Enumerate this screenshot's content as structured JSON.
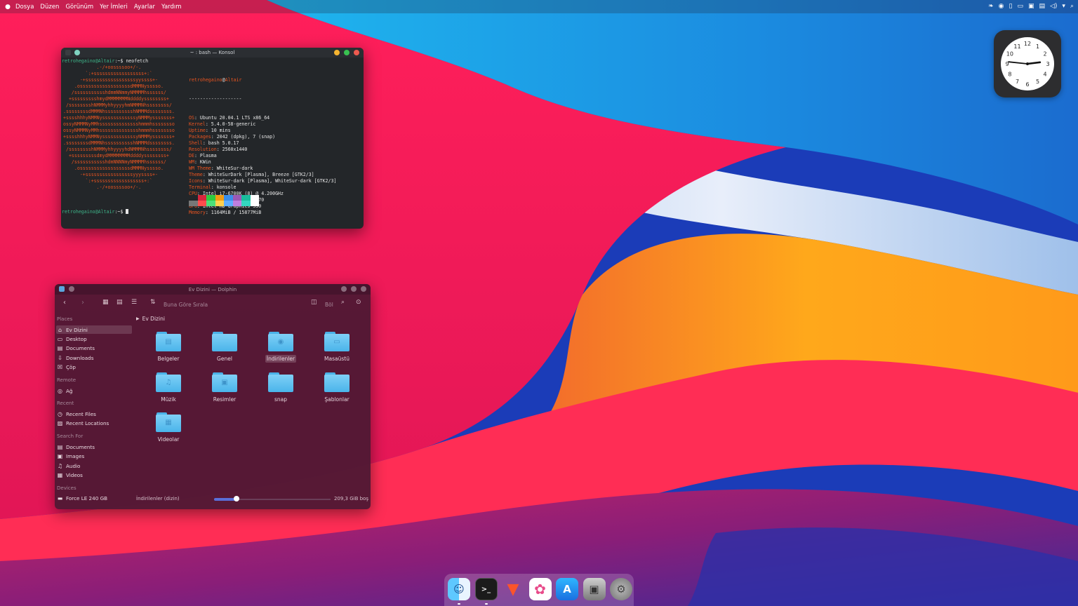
{
  "menubar": {
    "apple_icon": "apple-icon",
    "items": [
      "Dosya",
      "Düzen",
      "Görünüm",
      "Yer İmleri",
      "Ayarlar",
      "Yardım"
    ],
    "tray_icons": [
      "kde-connect-icon",
      "location-icon",
      "clipboard-icon",
      "display-icon",
      "battery-icon",
      "network-icon",
      "volume-icon",
      "chevron-down-icon",
      "search-icon"
    ]
  },
  "clock": {
    "numbers": [
      "12",
      "1",
      "2",
      "3",
      "4",
      "5",
      "6",
      "7",
      "8",
      "9",
      "10",
      "11"
    ],
    "hour": 2,
    "minute": 46
  },
  "konsole": {
    "title": "~ : bash — Konsol",
    "prompt_user": "retrohegaino@Altair",
    "prompt_suffix": ":~$",
    "command": " neofetch",
    "ascii_art": "            .-/+oossssoo+/-.\n        `:+ssssssssssssssssss+:`\n      -+ssssssssssssssssssyyssss+-\n    .ossssssssssssssssssdMMMNysssso.\n   /ssssssssssshdmmNNmmyNMMMMhssssss/\n  +ssssssssshmydMMMMMMMNddddyssssssss+\n /sssssssshNMMMyhhyyyyhmNMMMNhssssssss/\n.ssssssssdMMMNhsssssssssshNMMMdssssssss.\n+sssshhhyNMMNyssssssssssssyNMMMysssssss+\nossyNMMMNyMMhsssssssssssssshmmmhssssssso\nossyNMMMNyMMhsssssssssssssshmmmhssssssso\n+sssshhhyNMMNyssssssssssssyNMMMysssssss+\n.ssssssssdMMMNhsssssssssshNMMMdssssssss.\n /sssssssshNMMMyhhyyyyhdNMMMNhssssssss/\n  +sssssssssdmydMMMMMMMMddddyssssssss+\n   /ssssssssssshdmNNNNmyNMMMMhssssss/\n    .ossssssssssssssssssdMMMNysssso.\n      -+sssssssssssssssssyyyssss+-\n        `:+ssssssssssssssssss+:`\n            .-/+oossssoo+/-.",
    "info_header_user": "retrohegaino",
    "info_header_at": "@",
    "info_header_host": "Altair",
    "info_separator": "-------------------",
    "info": [
      {
        "key": "OS",
        "value": ": Ubuntu 20.04.1 LTS x86_64"
      },
      {
        "key": "Kernel",
        "value": ": 5.4.0-58-generic"
      },
      {
        "key": "Uptime",
        "value": ": 10 mins"
      },
      {
        "key": "Packages",
        "value": ": 2042 (dpkg), 7 (snap)"
      },
      {
        "key": "Shell",
        "value": ": bash 5.0.17"
      },
      {
        "key": "Resolution",
        "value": ": 2560x1440"
      },
      {
        "key": "DE",
        "value": ": Plasma"
      },
      {
        "key": "WM",
        "value": ": KWin"
      },
      {
        "key": "WM Theme",
        "value": ": WhiteSur-dark"
      },
      {
        "key": "Theme",
        "value": ": WhiteSurDark [Plasma], Breeze [GTK2/3]"
      },
      {
        "key": "Icons",
        "value": ": WhiteSur-dark [Plasma], WhiteSur-dark [GTK2/3]"
      },
      {
        "key": "Terminal",
        "value": ": konsole"
      },
      {
        "key": "CPU",
        "value": ": Intel i7-6700K (8) @ 4.200GHz"
      },
      {
        "key": "GPU",
        "value": ": NVIDIA GeForce GTX 970"
      },
      {
        "key": "GPU",
        "value": ": Intel HD Graphics 530"
      },
      {
        "key": "Memory",
        "value": ": 1164MiB / 15877MiB"
      }
    ],
    "palette_top": [
      "#232629",
      "#d7263d",
      "#2ecc40",
      "#f39c12",
      "#3b8eea",
      "#9b59b6",
      "#1abc9c",
      "#ffffff"
    ],
    "palette_bottom": [
      "#777777",
      "#ff4d4d",
      "#4ce07a",
      "#ffd04d",
      "#5dadff",
      "#c07fe0",
      "#33d6c0",
      "#ffffff"
    ],
    "prompt2_user": "retrohegaino@Altair",
    "prompt2_suffix": ":~$"
  },
  "dolphin": {
    "title": "Ev Dizini — Dolphin",
    "toolbar": {
      "sort_label": "Buna Göre Sırala",
      "split_label": "Böl"
    },
    "sidebar": {
      "sections": [
        {
          "title": "Places",
          "items": [
            {
              "label": "Ev Dizini",
              "icon": "home-icon",
              "active": true
            },
            {
              "label": "Desktop",
              "icon": "desktop-icon"
            },
            {
              "label": "Documents",
              "icon": "documents-icon"
            },
            {
              "label": "Downloads",
              "icon": "downloads-icon"
            },
            {
              "label": "Çöp",
              "icon": "trash-icon"
            }
          ]
        },
        {
          "title": "Remote",
          "items": [
            {
              "label": "Ağ",
              "icon": "network-icon"
            }
          ]
        },
        {
          "title": "Recent",
          "items": [
            {
              "label": "Recent Files",
              "icon": "recent-files-icon"
            },
            {
              "label": "Recent Locations",
              "icon": "recent-locations-icon"
            }
          ]
        },
        {
          "title": "Search For",
          "items": [
            {
              "label": "Documents",
              "icon": "documents-icon"
            },
            {
              "label": "Images",
              "icon": "images-icon"
            },
            {
              "label": "Audio",
              "icon": "audio-icon"
            },
            {
              "label": "Videos",
              "icon": "videos-icon"
            }
          ]
        },
        {
          "title": "Devices",
          "items": [
            {
              "label": "Force LE 240 GB",
              "icon": "drive-icon"
            }
          ]
        }
      ]
    },
    "breadcrumb": "Ev Dizini",
    "files": [
      {
        "name": "Belgeler",
        "icon": "documents-folder-icon"
      },
      {
        "name": "Genel",
        "icon": "public-folder-icon"
      },
      {
        "name": "İndirilenler",
        "icon": "downloads-folder-icon",
        "selected": true
      },
      {
        "name": "Masaüstü",
        "icon": "desktop-folder-icon"
      },
      {
        "name": "Müzik",
        "icon": "music-folder-icon"
      },
      {
        "name": "Resimler",
        "icon": "pictures-folder-icon"
      },
      {
        "name": "snap",
        "icon": "folder-icon"
      },
      {
        "name": "Şablonlar",
        "icon": "templates-folder-icon"
      },
      {
        "name": "Videolar",
        "icon": "videos-folder-icon"
      }
    ],
    "status": {
      "selection": "İndirilenler (dizin)",
      "free_space": "209,3 GiB boş",
      "zoom_level": 0.19
    }
  },
  "dock": {
    "apps": [
      {
        "name": "finder-icon",
        "label": "Dolphin"
      },
      {
        "name": "terminal-icon",
        "label": ">_"
      },
      {
        "name": "brave-icon",
        "label": "Brave"
      },
      {
        "name": "photos-icon",
        "label": "Photos"
      },
      {
        "name": "app-store-icon",
        "label": "Discover"
      },
      {
        "name": "disk-utility-icon",
        "label": "Disks"
      },
      {
        "name": "system-settings-icon",
        "label": "Settings"
      }
    ]
  }
}
